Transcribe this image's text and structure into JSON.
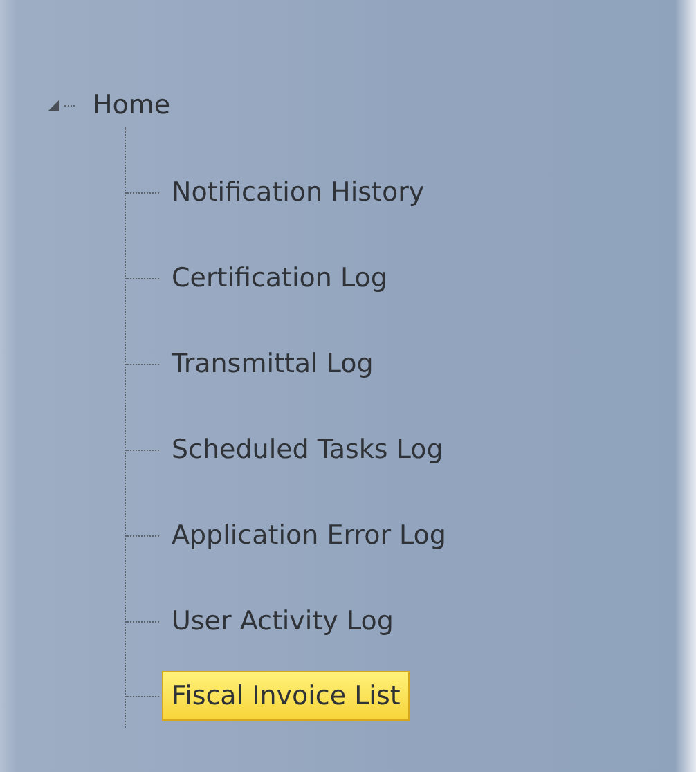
{
  "tree": {
    "label": "Home",
    "expanded": true,
    "children": [
      {
        "label": "Notification History",
        "selected": false
      },
      {
        "label": "Certification Log",
        "selected": false
      },
      {
        "label": "Transmittal Log",
        "selected": false
      },
      {
        "label": "Scheduled Tasks Log",
        "selected": false
      },
      {
        "label": "Application Error Log",
        "selected": false
      },
      {
        "label": "User Activity Log",
        "selected": false
      },
      {
        "label": "Fiscal Invoice List",
        "selected": true
      }
    ]
  }
}
